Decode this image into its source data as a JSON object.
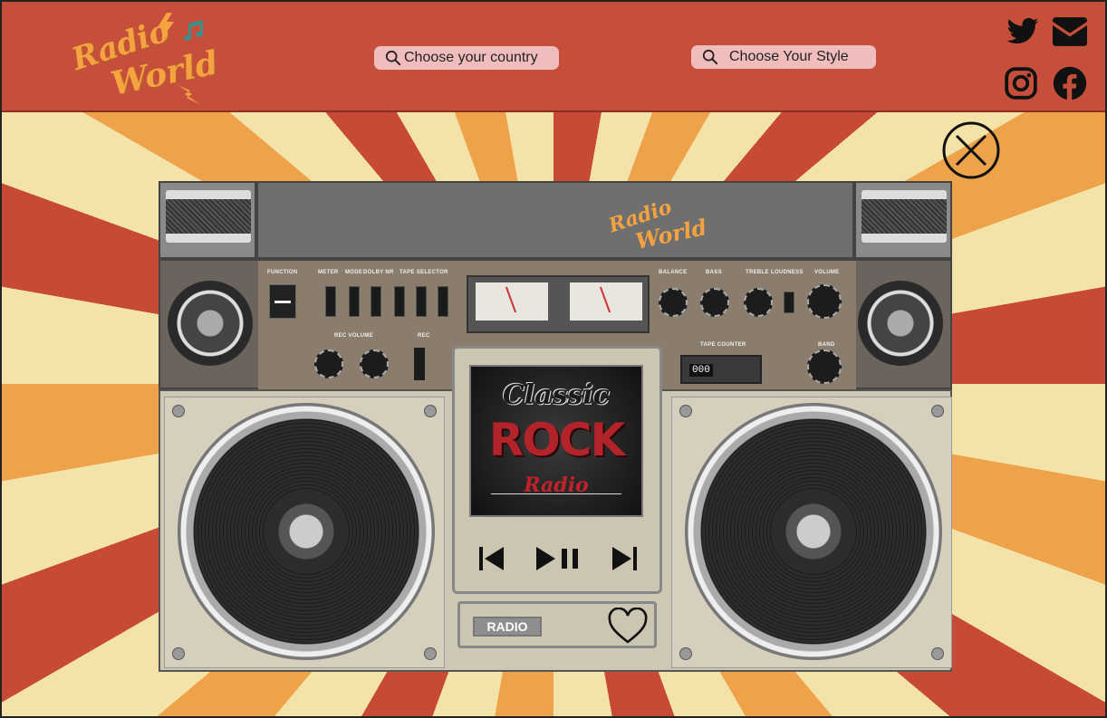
{
  "header": {
    "logo": {
      "line1": "Radio",
      "line2": "World"
    },
    "search_country": {
      "label": "Choose your country",
      "icon": "search-icon"
    },
    "search_style": {
      "label": "Choose Your Style",
      "icon": "search-icon"
    },
    "social": [
      {
        "name": "twitter",
        "icon": "twitter-icon"
      },
      {
        "name": "email",
        "icon": "mail-icon"
      },
      {
        "name": "instagram",
        "icon": "instagram-icon"
      },
      {
        "name": "facebook",
        "icon": "facebook-icon"
      }
    ]
  },
  "modal": {
    "close_icon": "close-icon",
    "boombox": {
      "logo": {
        "line1": "Radio",
        "line2": "World"
      },
      "station": {
        "line1": "Classic",
        "line2": "ROCK",
        "line3": "Radio"
      },
      "controls": {
        "labels": [
          "FUNCTION",
          "METER",
          "MODE",
          "DOLBY NR",
          "TAPE SELECTOR",
          "BALANCE",
          "BASS",
          "TREBLE",
          "LOUDNESS",
          "VOLUME",
          "REC VOLUME",
          "REC",
          "TAPE COUNTER",
          "BAND"
        ],
        "tape_counter": "000",
        "prev_icon": "skip-previous-icon",
        "playpause_icon": "play-pause-icon",
        "next_icon": "skip-next-icon"
      },
      "mode_label": "RADIO",
      "favorite_icon": "heart-icon"
    }
  },
  "colors": {
    "header_bg": "#c64f3b",
    "search_pill": "#f0bcbc",
    "logo_orange": "#f4a340",
    "sunburst_red": "#c64a36",
    "sunburst_orange": "#eea24a",
    "sunburst_cream": "#f4e3a8"
  }
}
